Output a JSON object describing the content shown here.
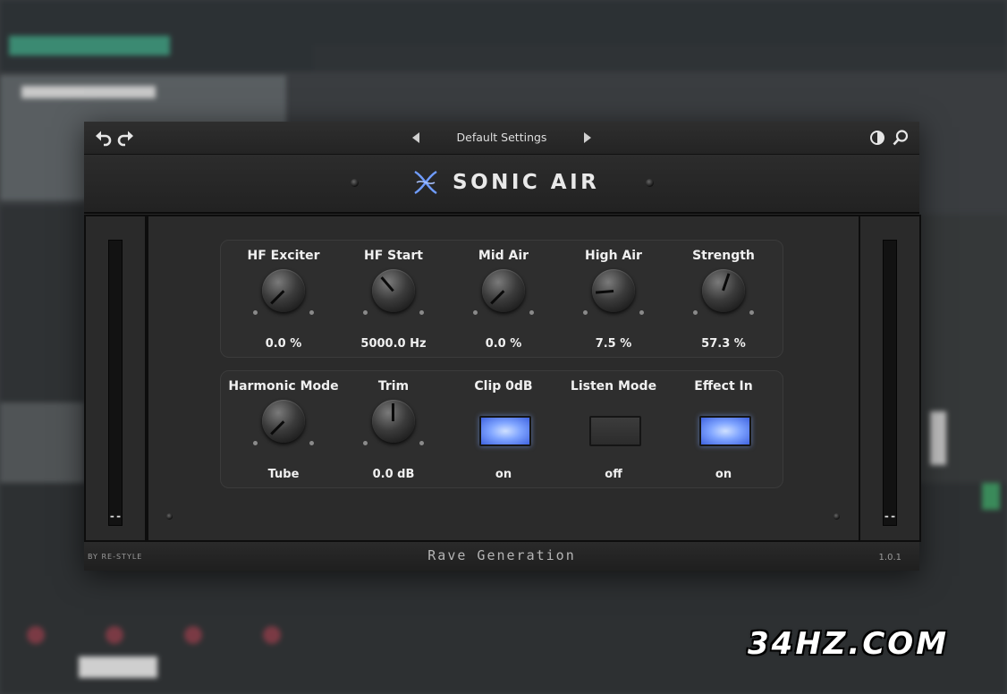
{
  "plugin": {
    "preset_name": "Default Settings",
    "title": "SONIC AIR",
    "footer_by": "BY RE-STYLE",
    "footer_brand": "Rave Generation",
    "version": "1.0.1",
    "accent_on_color": "#7fa4ff"
  },
  "toolbar": {
    "undo_icon": "undo-icon",
    "redo_icon": "redo-icon",
    "prev_icon": "triangle-left-icon",
    "next_icon": "triangle-right-icon",
    "compare_icon": "half-circle-icon",
    "search_icon": "magnifier-icon"
  },
  "meters": {
    "left_value": "--",
    "right_value": "--"
  },
  "row1": [
    {
      "label": "HF Exciter",
      "value": "0.0 %",
      "knob_fraction": 0.0
    },
    {
      "label": "HF Start",
      "value": "5000.0 Hz",
      "knob_fraction": 0.35
    },
    {
      "label": "Mid Air",
      "value": "0.0 %",
      "knob_fraction": 0.0
    },
    {
      "label": "High Air",
      "value": "7.5 %",
      "knob_fraction": 0.15
    },
    {
      "label": "Strength",
      "value": "57.3 %",
      "knob_fraction": 0.57
    }
  ],
  "row2": [
    {
      "label": "Harmonic Mode",
      "value": "Tube",
      "kind": "knob",
      "knob_fraction": 0.0
    },
    {
      "label": "Trim",
      "value": "0.0 dB",
      "kind": "knob",
      "knob_fraction": 0.5
    },
    {
      "label": "Clip 0dB",
      "value": "on",
      "kind": "button",
      "state": "on"
    },
    {
      "label": "Listen Mode",
      "value": "off",
      "kind": "button",
      "state": "off"
    },
    {
      "label": "Effect In",
      "value": "on",
      "kind": "button",
      "state": "on"
    }
  ],
  "watermark": "34HZ.COM"
}
